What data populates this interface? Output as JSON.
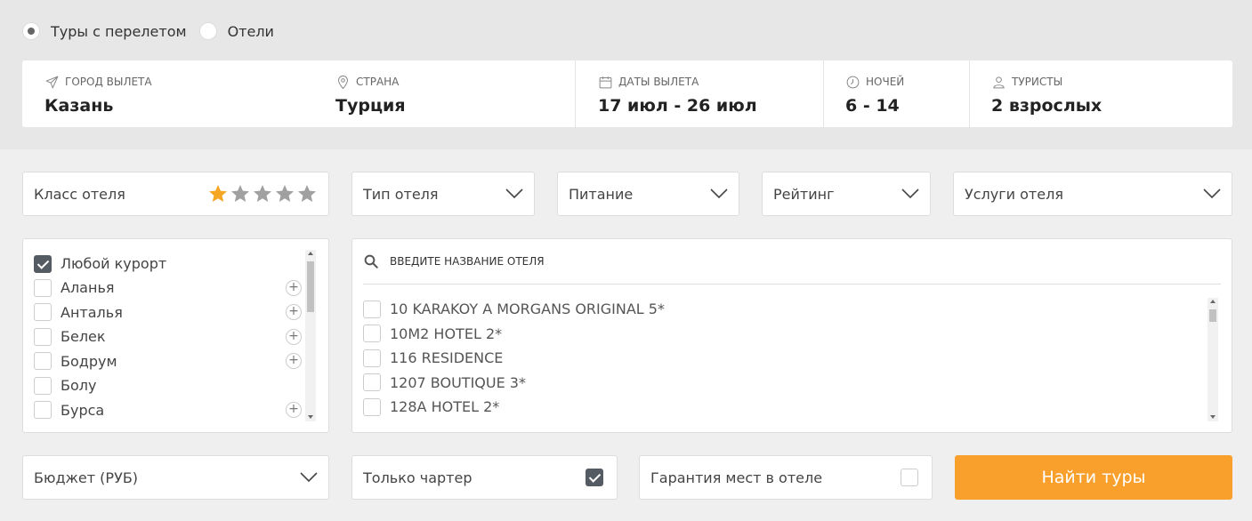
{
  "mode": {
    "options": [
      {
        "label": "Туры с перелетом",
        "selected": true
      },
      {
        "label": "Отели",
        "selected": false
      }
    ]
  },
  "search": {
    "departure": {
      "label": "ГОРОД ВЫЛЕТА",
      "value": "Казань",
      "icon": "plane-icon"
    },
    "country": {
      "label": "СТРАНА",
      "value": "Турция",
      "icon": "location-pin-icon"
    },
    "dates": {
      "label": "ДАТЫ ВЫЛЕТА",
      "value": "17 июл - 26 июл",
      "icon": "calendar-icon"
    },
    "nights": {
      "label": "НОЧЕЙ",
      "value": "6 - 14",
      "icon": "clock-icon"
    },
    "tourists": {
      "label": "ТУРИСТЫ",
      "value": "2 взрослых",
      "icon": "user-icon"
    }
  },
  "filters": {
    "hotel_class": {
      "label": "Класс отеля",
      "stars_selected": 1,
      "stars_total": 5
    },
    "hotel_type": {
      "label": "Тип отеля"
    },
    "meals": {
      "label": "Питание"
    },
    "rating": {
      "label": "Рейтинг"
    },
    "services": {
      "label": "Услуги отеля"
    }
  },
  "resorts": [
    {
      "label": "Любой курорт",
      "checked": true,
      "expandable": false
    },
    {
      "label": "Аланья",
      "checked": false,
      "expandable": true
    },
    {
      "label": "Анталья",
      "checked": false,
      "expandable": true
    },
    {
      "label": "Белек",
      "checked": false,
      "expandable": true
    },
    {
      "label": "Бодрум",
      "checked": false,
      "expandable": true
    },
    {
      "label": "Болу",
      "checked": false,
      "expandable": false
    },
    {
      "label": "Бурса",
      "checked": false,
      "expandable": true
    }
  ],
  "hotels": {
    "search_placeholder": "ВВЕДИТЕ НАЗВАНИЕ ОТЕЛЯ",
    "items": [
      "10 KARAKOY A MORGANS ORIGINAL 5*",
      "10M2 HOTEL 2*",
      "116 RESIDENCE",
      "1207 BOUTIQUE 3*",
      "128A HOTEL 2*"
    ]
  },
  "bottom": {
    "budget": {
      "label": "Бюджет (РУБ)"
    },
    "charter": {
      "label": "Только чартер",
      "checked": true
    },
    "guarantee": {
      "label": "Гарантия мест в отеле",
      "checked": false
    },
    "find_button": "Найти туры"
  },
  "colors": {
    "accent": "#f9a02c",
    "star_active": "#f5a623",
    "star_inactive": "#a0a0a0"
  }
}
